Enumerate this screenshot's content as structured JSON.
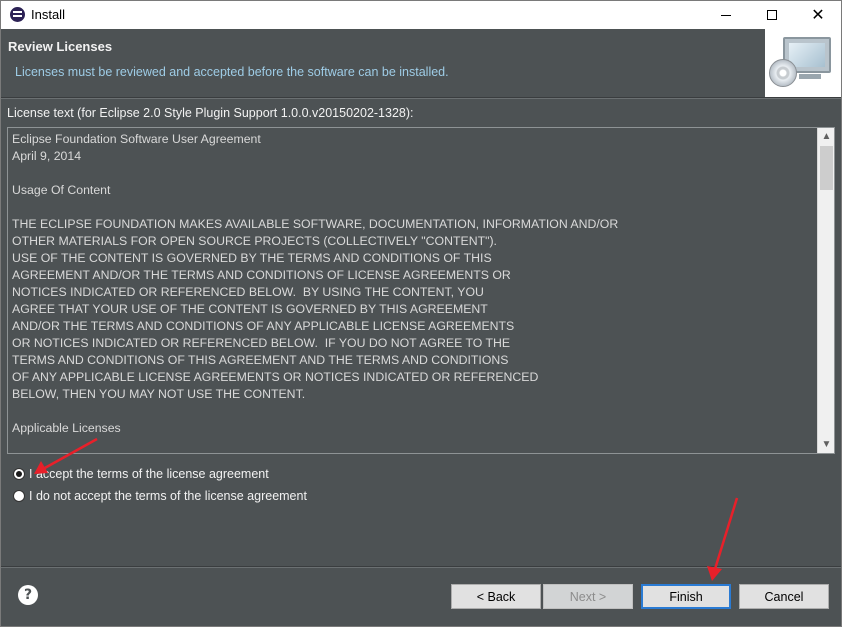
{
  "window": {
    "title": "Install"
  },
  "header": {
    "title": "Review Licenses",
    "description": "Licenses must be reviewed and accepted before the software can be installed."
  },
  "license": {
    "label": "License text (for Eclipse 2.0 Style Plugin Support 1.0.0.v20150202-1328):",
    "lines": [
      "Eclipse Foundation Software User Agreement",
      "April 9, 2014",
      "",
      "Usage Of Content",
      "",
      "THE ECLIPSE FOUNDATION MAKES AVAILABLE SOFTWARE, DOCUMENTATION, INFORMATION AND/OR",
      "OTHER MATERIALS FOR OPEN SOURCE PROJECTS (COLLECTIVELY \"CONTENT\").",
      "USE OF THE CONTENT IS GOVERNED BY THE TERMS AND CONDITIONS OF THIS",
      "AGREEMENT AND/OR THE TERMS AND CONDITIONS OF LICENSE AGREEMENTS OR",
      "NOTICES INDICATED OR REFERENCED BELOW.  BY USING THE CONTENT, YOU",
      "AGREE THAT YOUR USE OF THE CONTENT IS GOVERNED BY THIS AGREEMENT",
      "AND/OR THE TERMS AND CONDITIONS OF ANY APPLICABLE LICENSE AGREEMENTS",
      "OR NOTICES INDICATED OR REFERENCED BELOW.  IF YOU DO NOT AGREE TO THE",
      "TERMS AND CONDITIONS OF THIS AGREEMENT AND THE TERMS AND CONDITIONS",
      "OF ANY APPLICABLE LICENSE AGREEMENTS OR NOTICES INDICATED OR REFERENCED",
      "BELOW, THEN YOU MAY NOT USE THE CONTENT.",
      "",
      "Applicable Licenses"
    ]
  },
  "options": {
    "accept_label": "I accept the terms of the license agreement",
    "decline_label": "I do not accept the terms of the license agreement",
    "selected": "accept"
  },
  "buttons": {
    "back": "< Back",
    "next": "Next >",
    "finish": "Finish",
    "cancel": "Cancel"
  },
  "icons": {
    "help": "?",
    "close": "✕"
  },
  "colors": {
    "dialog_bg": "#4d5254",
    "description_text": "#9ecce6",
    "annotation_arrow": "#e8202a",
    "focus_border": "#2a7bd4"
  }
}
